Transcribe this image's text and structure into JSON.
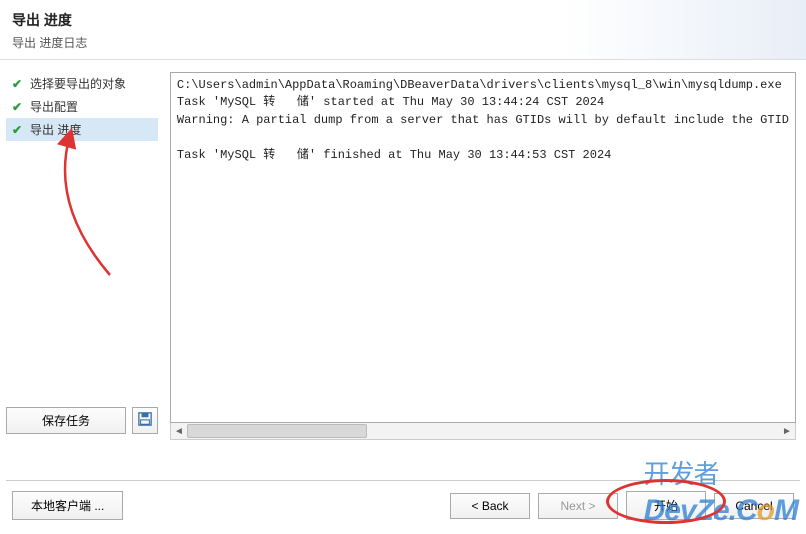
{
  "header": {
    "title": "导出 进度",
    "subtitle": "导出 进度日志"
  },
  "sidebar": {
    "steps": [
      {
        "label": "选择要导出的对象",
        "done": true
      },
      {
        "label": "导出配置",
        "done": true
      },
      {
        "label": "导出 进度",
        "done": true,
        "active": true
      }
    ],
    "save_task_label": "保存任务"
  },
  "log": {
    "lines": [
      "C:\\Users\\admin\\AppData\\Roaming\\DBeaverData\\drivers\\clients\\mysql_8\\win\\mysqldump.exe",
      "Task 'MySQL 转   储' started at Thu May 30 13:44:24 CST 2024",
      "Warning: A partial dump from a server that has GTIDs will by default include the GTID",
      "",
      "Task 'MySQL 转   储' finished at Thu May 30 13:44:53 CST 2024"
    ]
  },
  "buttons": {
    "local_client": "本地客户端 ...",
    "back": "< Back",
    "next": "Next >",
    "start": "开始",
    "cancel": "Cancel"
  },
  "watermark": {
    "cn": "开发者",
    "lat": "DevZe.CoM"
  }
}
